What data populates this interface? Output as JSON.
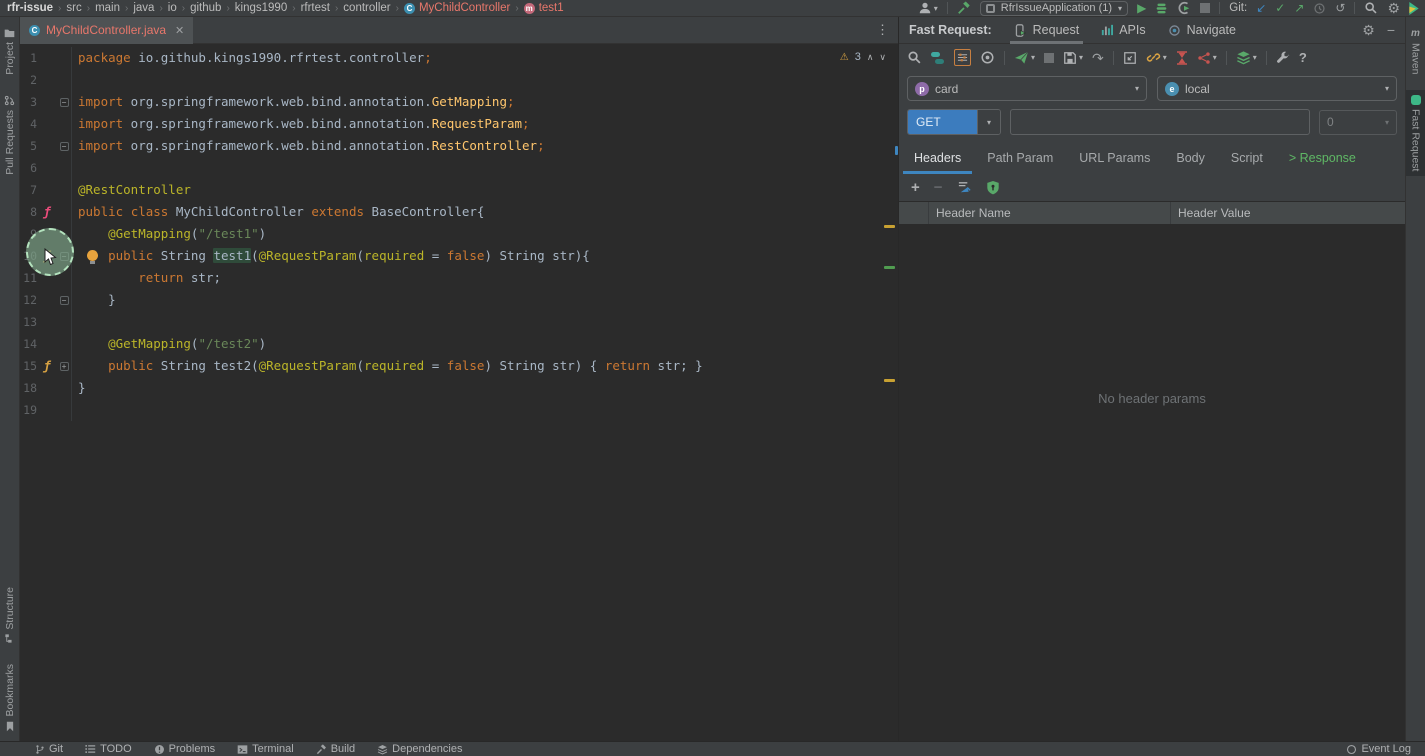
{
  "breadcrumb": {
    "project": "rfr-issue",
    "path": [
      "src",
      "main",
      "java",
      "io",
      "github",
      "kings1990",
      "rfrtest",
      "controller"
    ],
    "class_item": "MyChildController",
    "method_item": "test1"
  },
  "topbar": {
    "run_config": "RfrIssueApplication (1)",
    "git_label": "Git:"
  },
  "editor": {
    "tab_title": "MyChildController.java",
    "warnings_count": "3"
  },
  "left_stripe": {
    "items": [
      "Project",
      "Pull Requests",
      "Structure",
      "Bookmarks"
    ]
  },
  "right_stripe": {
    "items": [
      "Maven",
      "Fast Request"
    ]
  },
  "bottom_bar": {
    "items": [
      "Git",
      "TODO",
      "Problems",
      "Terminal",
      "Build",
      "Dependencies"
    ],
    "event_log": "Event Log"
  },
  "fast_request": {
    "title": "Fast Request:",
    "tabs": [
      "Request",
      "APIs",
      "Navigate"
    ],
    "project_select": "card",
    "env_select": "local",
    "method": "GET",
    "url_value": "",
    "count": "0",
    "help_label": "?",
    "req_tabs": [
      "Headers",
      "Path Param",
      "URL Params",
      "Body",
      "Script",
      "> Response"
    ],
    "table": {
      "columns": [
        "Header Name",
        "Header Value"
      ],
      "empty_text": "No header params"
    }
  },
  "colors": {
    "accent_blue": "#3E86C0",
    "method_blue": "#3C7CBE",
    "response_green": "#5FB865",
    "error_salmon": "#E8776B",
    "warning_yellow": "#D9A343"
  },
  "code": {
    "lines": [
      {
        "num": "1",
        "tokens": [
          [
            "kw",
            "package"
          ],
          [
            "pl",
            " io.github.kings1990.rfrtest.controller"
          ],
          [
            "kw",
            ";"
          ]
        ]
      },
      {
        "num": "2",
        "tokens": []
      },
      {
        "num": "3",
        "fold": "-",
        "tokens": [
          [
            "kw",
            "import"
          ],
          [
            "pl",
            " org.springframework.web.bind.annotation."
          ],
          [
            "cl",
            "GetMapping"
          ],
          [
            "kw",
            ";"
          ]
        ]
      },
      {
        "num": "4",
        "tokens": [
          [
            "kw",
            "import"
          ],
          [
            "pl",
            " org.springframework.web.bind.annotation."
          ],
          [
            "cl",
            "RequestParam"
          ],
          [
            "kw",
            ";"
          ]
        ]
      },
      {
        "num": "5",
        "fold": "-",
        "tokens": [
          [
            "kw",
            "import"
          ],
          [
            "pl",
            " org.springframework.web.bind.annotation."
          ],
          [
            "cl",
            "RestController"
          ],
          [
            "kw",
            ";"
          ]
        ]
      },
      {
        "num": "6",
        "tokens": []
      },
      {
        "num": "7",
        "tokens": [
          [
            "an",
            "@RestController"
          ]
        ]
      },
      {
        "num": "8",
        "icon": "pink",
        "tokens": [
          [
            "kw",
            "public"
          ],
          [
            "pl",
            " "
          ],
          [
            "kw",
            "class"
          ],
          [
            "pl",
            " MyChildController "
          ],
          [
            "kw",
            "extends"
          ],
          [
            "pl",
            " BaseController{"
          ]
        ]
      },
      {
        "num": "9",
        "tokens": [
          [
            "pl",
            "    "
          ],
          [
            "an",
            "@GetMapping"
          ],
          [
            "pl",
            "("
          ],
          [
            "st",
            "\"/test1\""
          ],
          [
            "pl",
            ")"
          ]
        ]
      },
      {
        "num": "10",
        "icon": "yellow",
        "fold": "-",
        "tokens": [
          [
            "pl",
            "    "
          ],
          [
            "kw",
            "public"
          ],
          [
            "pl",
            " String "
          ],
          [
            "hl",
            "test1"
          ],
          [
            "pl",
            "("
          ],
          [
            "an",
            "@RequestParam"
          ],
          [
            "pl",
            "("
          ],
          [
            "an",
            "required"
          ],
          [
            "pl",
            " = "
          ],
          [
            "kw",
            "false"
          ],
          [
            "pl",
            ") String str){"
          ]
        ]
      },
      {
        "num": "11",
        "tokens": [
          [
            "pl",
            "        "
          ],
          [
            "kw",
            "return"
          ],
          [
            "pl",
            " str;"
          ]
        ]
      },
      {
        "num": "12",
        "fold": "-",
        "tokens": [
          [
            "pl",
            "    }"
          ]
        ]
      },
      {
        "num": "13",
        "tokens": []
      },
      {
        "num": "14",
        "tokens": [
          [
            "pl",
            "    "
          ],
          [
            "an",
            "@GetMapping"
          ],
          [
            "pl",
            "("
          ],
          [
            "st",
            "\"/test2\""
          ],
          [
            "pl",
            ")"
          ]
        ]
      },
      {
        "num": "15",
        "icon": "yellow",
        "fold": "+",
        "tokens": [
          [
            "pl",
            "    "
          ],
          [
            "kw",
            "public"
          ],
          [
            "pl",
            " String test2("
          ],
          [
            "an",
            "@RequestParam"
          ],
          [
            "pl",
            "("
          ],
          [
            "an",
            "required"
          ],
          [
            "pl",
            " = "
          ],
          [
            "kw",
            "false"
          ],
          [
            "pl",
            ") String str) { "
          ],
          [
            "kw",
            "return"
          ],
          [
            "pl",
            " str; }"
          ]
        ]
      },
      {
        "num": "18",
        "tokens": [
          [
            "pl",
            "}"
          ]
        ]
      },
      {
        "num": "19",
        "tokens": []
      }
    ]
  }
}
